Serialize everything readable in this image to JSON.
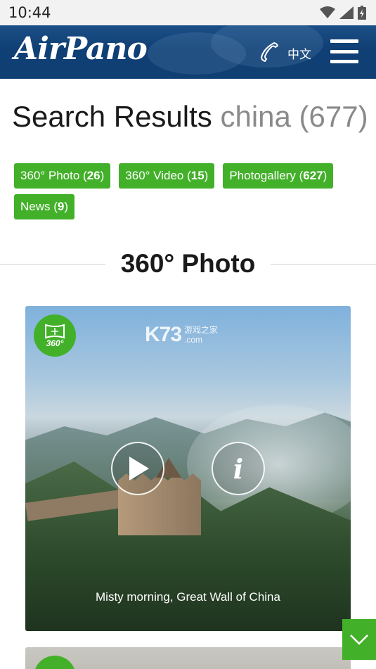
{
  "status_bar": {
    "time": "10:44",
    "icons": [
      "wifi-icon",
      "signal-icon",
      "battery-icon"
    ]
  },
  "header": {
    "logo": "AirPano",
    "phone_icon": "phone-icon",
    "language": "中文",
    "menu_icon": "hamburger-menu-icon"
  },
  "search": {
    "label": "Search Results",
    "query": "china",
    "count": "(677)"
  },
  "filters": [
    {
      "label": "360° Photo",
      "count": "26"
    },
    {
      "label": "360° Video",
      "count": "15"
    },
    {
      "label": "Photogallery",
      "count": "627"
    },
    {
      "label": "News",
      "count": "9"
    }
  ],
  "section": {
    "title": "360° Photo"
  },
  "results": [
    {
      "badge": "360°",
      "watermark_main": "K73",
      "watermark_sub1": "游戏之家",
      "watermark_sub2": ".com",
      "info_symbol": "i",
      "caption": "Misty morning, Great Wall of China"
    }
  ],
  "colors": {
    "accent_green": "#43b02a",
    "header_blue": "#103f73"
  }
}
